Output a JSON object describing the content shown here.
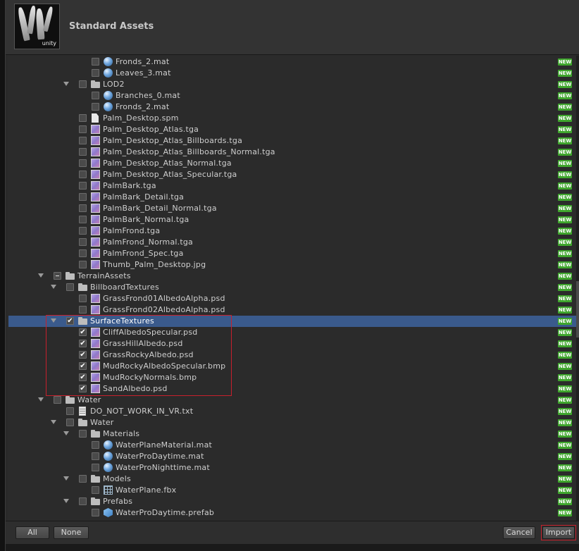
{
  "header": {
    "title": "Standard Assets",
    "logo_text": "unity"
  },
  "tree_rows": [
    {
      "depth": 4,
      "arrow": false,
      "check": "none",
      "icon": "material",
      "label": "Fronds_2.mat",
      "new": true
    },
    {
      "depth": 4,
      "arrow": false,
      "check": "none",
      "icon": "material",
      "label": "Leaves_3.mat",
      "new": true
    },
    {
      "depth": 3,
      "arrow": true,
      "check": "none",
      "icon": "folder",
      "label": "LOD2",
      "new": true
    },
    {
      "depth": 4,
      "arrow": false,
      "check": "none",
      "icon": "material",
      "label": "Branches_0.mat",
      "new": true
    },
    {
      "depth": 4,
      "arrow": false,
      "check": "none",
      "icon": "material",
      "label": "Fronds_2.mat",
      "new": true
    },
    {
      "depth": 3,
      "arrow": false,
      "check": "none",
      "icon": "file",
      "label": "Palm_Desktop.spm",
      "new": true
    },
    {
      "depth": 3,
      "arrow": false,
      "check": "none",
      "icon": "texture",
      "label": "Palm_Desktop_Atlas.tga",
      "new": true
    },
    {
      "depth": 3,
      "arrow": false,
      "check": "none",
      "icon": "texture",
      "label": "Palm_Desktop_Atlas_Billboards.tga",
      "new": true
    },
    {
      "depth": 3,
      "arrow": false,
      "check": "none",
      "icon": "texture",
      "label": "Palm_Desktop_Atlas_Billboards_Normal.tga",
      "new": true
    },
    {
      "depth": 3,
      "arrow": false,
      "check": "none",
      "icon": "texture",
      "label": "Palm_Desktop_Atlas_Normal.tga",
      "new": true
    },
    {
      "depth": 3,
      "arrow": false,
      "check": "none",
      "icon": "texture",
      "label": "Palm_Desktop_Atlas_Specular.tga",
      "new": true
    },
    {
      "depth": 3,
      "arrow": false,
      "check": "none",
      "icon": "texture",
      "label": "PalmBark.tga",
      "new": true
    },
    {
      "depth": 3,
      "arrow": false,
      "check": "none",
      "icon": "texture",
      "label": "PalmBark_Detail.tga",
      "new": true
    },
    {
      "depth": 3,
      "arrow": false,
      "check": "none",
      "icon": "texture",
      "label": "PalmBark_Detail_Normal.tga",
      "new": true
    },
    {
      "depth": 3,
      "arrow": false,
      "check": "none",
      "icon": "texture",
      "label": "PalmBark_Normal.tga",
      "new": true
    },
    {
      "depth": 3,
      "arrow": false,
      "check": "none",
      "icon": "texture",
      "label": "PalmFrond.tga",
      "new": true
    },
    {
      "depth": 3,
      "arrow": false,
      "check": "none",
      "icon": "texture",
      "label": "PalmFrond_Normal.tga",
      "new": true
    },
    {
      "depth": 3,
      "arrow": false,
      "check": "none",
      "icon": "texture",
      "label": "PalmFrond_Spec.tga",
      "new": true
    },
    {
      "depth": 3,
      "arrow": false,
      "check": "none",
      "icon": "texture",
      "label": "Thumb_Palm_Desktop.jpg",
      "new": true
    },
    {
      "depth": 1,
      "arrow": true,
      "check": "mixed",
      "icon": "folder",
      "label": "TerrainAssets",
      "new": true
    },
    {
      "depth": 2,
      "arrow": true,
      "check": "none",
      "icon": "folder",
      "label": "BillboardTextures",
      "new": true
    },
    {
      "depth": 3,
      "arrow": false,
      "check": "none",
      "icon": "texture",
      "label": "GrassFrond01AlbedoAlpha.psd",
      "new": true
    },
    {
      "depth": 3,
      "arrow": false,
      "check": "none",
      "icon": "texture",
      "label": "GrassFrond02AlbedoAlpha.psd",
      "new": true
    },
    {
      "depth": 2,
      "arrow": true,
      "check": "checked",
      "icon": "folder",
      "label": "SurfaceTextures",
      "new": true,
      "selected": true
    },
    {
      "depth": 3,
      "arrow": false,
      "check": "checked",
      "icon": "texture",
      "label": "CliffAlbedoSpecular.psd",
      "new": true
    },
    {
      "depth": 3,
      "arrow": false,
      "check": "checked",
      "icon": "texture",
      "label": "GrassHillAlbedo.psd",
      "new": true
    },
    {
      "depth": 3,
      "arrow": false,
      "check": "checked",
      "icon": "texture",
      "label": "GrassRockyAlbedo.psd",
      "new": true
    },
    {
      "depth": 3,
      "arrow": false,
      "check": "checked",
      "icon": "texture",
      "label": "MudRockyAlbedoSpecular.bmp",
      "new": true
    },
    {
      "depth": 3,
      "arrow": false,
      "check": "checked",
      "icon": "texture",
      "label": "MudRockyNormals.bmp",
      "new": true
    },
    {
      "depth": 3,
      "arrow": false,
      "check": "checked",
      "icon": "texture",
      "label": "SandAlbedo.psd",
      "new": true
    },
    {
      "depth": 1,
      "arrow": true,
      "check": "none",
      "icon": "folder",
      "label": "Water",
      "new": true
    },
    {
      "depth": 2,
      "arrow": false,
      "check": "none",
      "icon": "text",
      "label": "DO_NOT_WORK_IN_VR.txt",
      "new": true
    },
    {
      "depth": 2,
      "arrow": true,
      "check": "none",
      "icon": "folder",
      "label": "Water",
      "new": true
    },
    {
      "depth": 3,
      "arrow": true,
      "check": "none",
      "icon": "folder",
      "label": "Materials",
      "new": true
    },
    {
      "depth": 4,
      "arrow": false,
      "check": "none",
      "icon": "material",
      "label": "WaterPlaneMaterial.mat",
      "new": true
    },
    {
      "depth": 4,
      "arrow": false,
      "check": "none",
      "icon": "material",
      "label": "WaterProDaytime.mat",
      "new": true
    },
    {
      "depth": 4,
      "arrow": false,
      "check": "none",
      "icon": "material",
      "label": "WaterProNighttime.mat",
      "new": true
    },
    {
      "depth": 3,
      "arrow": true,
      "check": "none",
      "icon": "folder",
      "label": "Models",
      "new": true
    },
    {
      "depth": 4,
      "arrow": false,
      "check": "none",
      "icon": "mesh",
      "label": "WaterPlane.fbx",
      "new": true
    },
    {
      "depth": 3,
      "arrow": true,
      "check": "none",
      "icon": "folder",
      "label": "Prefabs",
      "new": true
    },
    {
      "depth": 4,
      "arrow": false,
      "check": "none",
      "icon": "prefab",
      "label": "WaterProDaytime.prefab",
      "new": true
    }
  ],
  "badge_text": "NEW",
  "footer": {
    "all_label": "All",
    "none_label": "None",
    "cancel_label": "Cancel",
    "import_label": "Import"
  },
  "colors": {
    "selection": "#3a5a8c",
    "new_badge": "#3fa62d",
    "highlight_outline": "#c8202c"
  }
}
